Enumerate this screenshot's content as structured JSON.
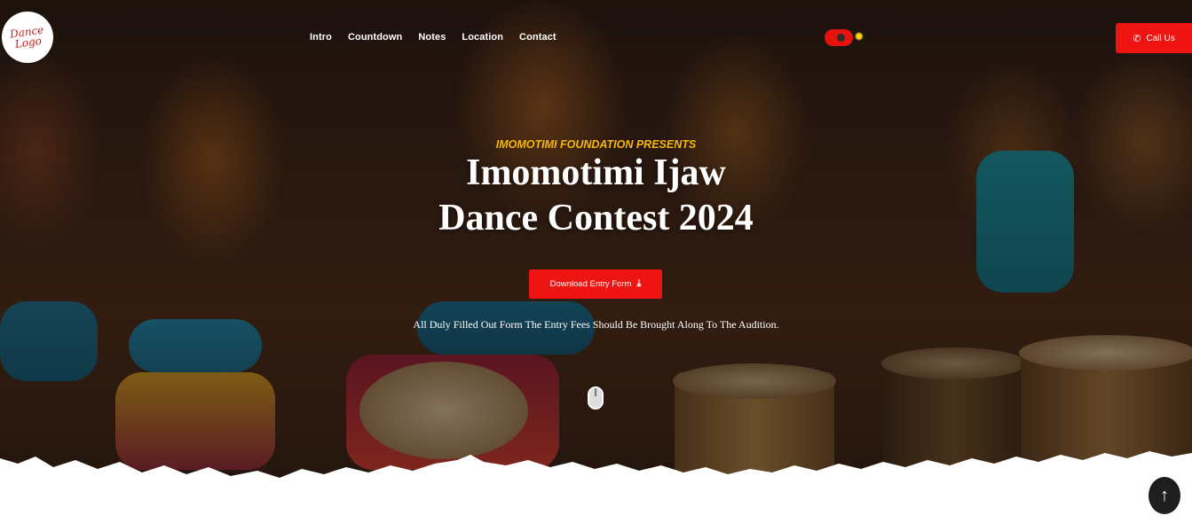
{
  "header": {
    "logo_line1": "Dance",
    "logo_line2": "Logo",
    "nav": [
      "Intro",
      "Countdown",
      "Notes",
      "Location",
      "Contact"
    ],
    "theme_toggle_icon": "sun-icon",
    "call_label": "Call Us",
    "call_icon": "phone-icon"
  },
  "hero": {
    "kicker": "IMOMOTIMI FOUNDATION PRESENTS",
    "title_line1": "Imomotimi Ijaw",
    "title_line2": "Dance Contest 2024",
    "download_label": "Download Entry Form",
    "download_icon": "download-icon",
    "note": "All Duly Filled Out Form The Entry Fees Should Be Brought Along To The Audition.",
    "scroll_indicator": "mouse-icon"
  },
  "scroll_top_icon": "arrow-up-icon",
  "colors": {
    "accent": "#ee1411",
    "kicker": "#f5b70c",
    "sun": "#f4d40d"
  }
}
